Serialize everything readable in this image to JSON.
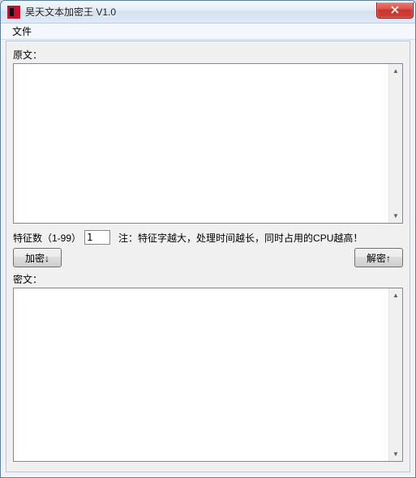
{
  "window": {
    "title": "昊天文本加密王 V1.0",
    "close_tooltip": "Close"
  },
  "menu": {
    "file": "文件"
  },
  "labels": {
    "original": "原文：",
    "cipher": "密文：",
    "feature_prefix": "特征数（1-99）",
    "hint": "注：特征字越大，处理时间越长，同时占用的CPU越高！"
  },
  "inputs": {
    "feature_value": "1",
    "original_text": "",
    "cipher_text": ""
  },
  "buttons": {
    "encrypt": "加密↓",
    "decrypt": "解密↑"
  }
}
